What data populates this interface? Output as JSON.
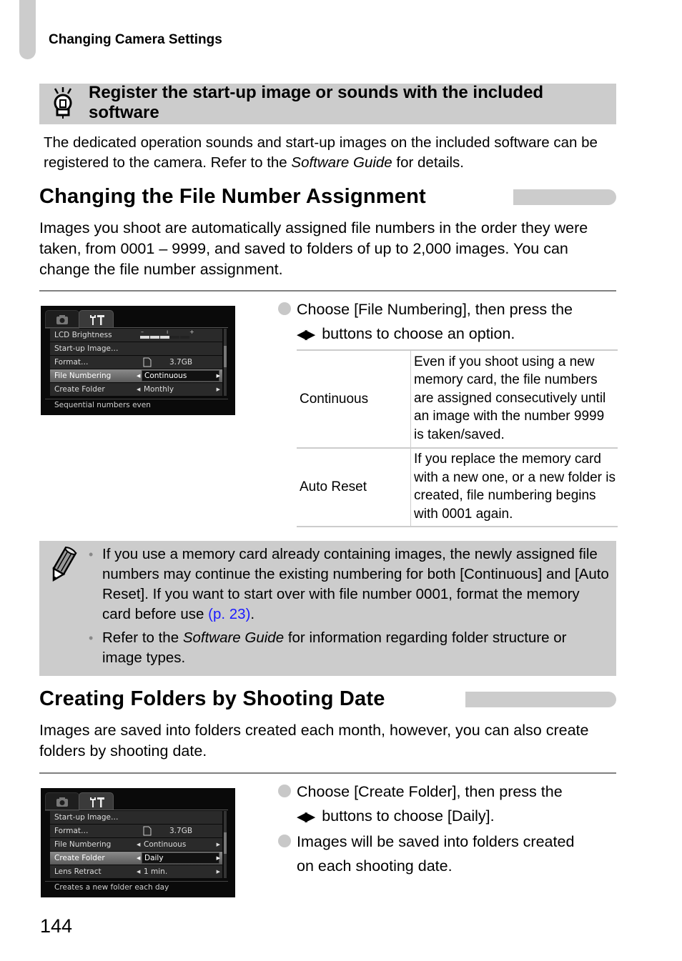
{
  "running_head": "Changing Camera Settings",
  "tip": {
    "icon": "lightbulb-icon",
    "title": "Register the start-up image or sounds with the included software",
    "body_before": "The dedicated operation sounds and start-up images on the included software can be registered to the camera. Refer to the ",
    "body_italic": "Software Guide",
    "body_after": " for details."
  },
  "section1": {
    "heading": "Changing the File Number Assignment",
    "intro": "Images you shoot are automatically assigned file numbers in the order they were taken, from 0001 – 9999, and saved to folders of up to 2,000 images. You can change the file number assignment.",
    "screen": {
      "tabs": [
        "camera-icon",
        "settings-tools-icon"
      ],
      "rows": [
        {
          "label": "LCD Brightness",
          "value": "",
          "type": "slider",
          "brightness_level": "3/5"
        },
        {
          "label": "Start-up Image…",
          "value": ""
        },
        {
          "label": "Format…",
          "value": "3.7GB",
          "icon": "memory-card-icon"
        },
        {
          "label": "File Numbering",
          "value": "Continuous",
          "selected": true
        },
        {
          "label": "Create Folder",
          "value": "Monthly"
        }
      ],
      "footer": "Sequential numbers even"
    },
    "step_line1": "Choose [File Numbering], then press the",
    "step_line2": "buttons to choose an option.",
    "step_arrows_icon": "left-right-arrows-icon",
    "options": [
      {
        "name": "Continuous",
        "desc": "Even if you shoot using a new memory card, the file numbers are assigned consecutively until an image with the number 9999 is taken/saved."
      },
      {
        "name": "Auto Reset",
        "desc": "If you replace the memory card with a new one, or a new folder is created, file numbering begins with 0001 again."
      }
    ]
  },
  "note": {
    "icon": "pencil-icon",
    "item1_text": "If you use a memory card already containing images, the newly assigned file numbers may continue the existing numbering for both [Continuous] and [Auto Reset]. If you want to start over with file number 0001, format the memory card before use ",
    "item1_link": "(p. 23)",
    "item1_end": ".",
    "item2_before": "Refer to the ",
    "item2_italic": "Software Guide",
    "item2_after": " for information regarding folder structure or image types.",
    "link_color": "#1a1aff"
  },
  "section2": {
    "heading": "Creating Folders by Shooting Date",
    "intro": "Images are saved into folders created each month, however, you can also create folders by shooting date.",
    "screen": {
      "tabs": [
        "camera-icon",
        "settings-tools-icon"
      ],
      "rows": [
        {
          "label": "Start-up Image…",
          "value": ""
        },
        {
          "label": "Format…",
          "value": "3.7GB",
          "icon": "memory-card-icon"
        },
        {
          "label": "File Numbering",
          "value": "Continuous"
        },
        {
          "label": "Create Folder",
          "value": "Daily",
          "selected": true
        },
        {
          "label": "Lens Retract",
          "value": "1 min."
        }
      ],
      "footer": "Creates a new folder each day"
    },
    "step1_line1": "Choose [Create Folder], then press the",
    "step1_line2": "buttons to choose [Daily].",
    "step2_line1": "Images will be saved into folders created",
    "step2_line2": "on each shooting date."
  },
  "page_number": "144"
}
